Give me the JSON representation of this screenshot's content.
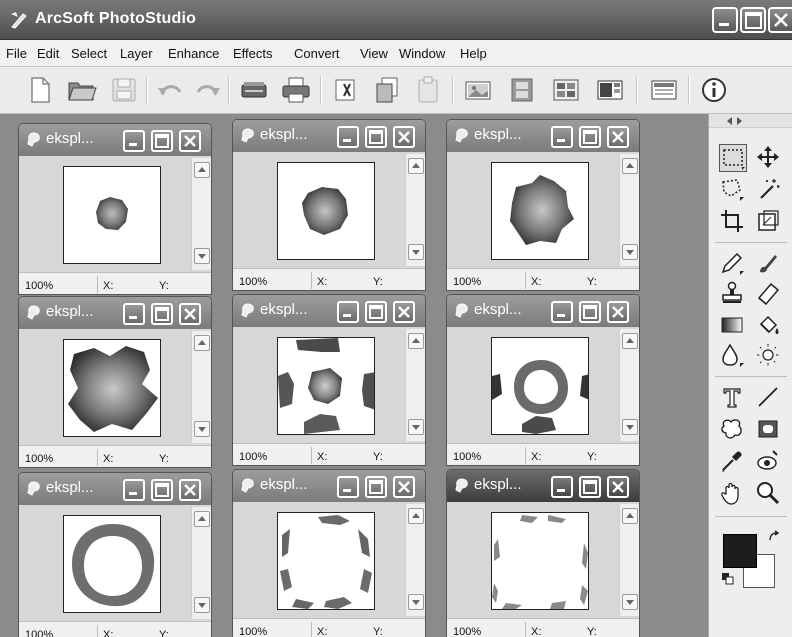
{
  "app": {
    "title": "ArcSoft PhotoStudio"
  },
  "menu": [
    "File",
    "Edit",
    "Select",
    "Layer",
    "Enhance",
    "Effects",
    "Convert",
    "View",
    "Window",
    "Help"
  ],
  "toolbar_icons": [
    "new-file-icon",
    "open-folder-icon",
    "save-icon",
    "undo-icon",
    "redo-icon",
    "scanner-icon",
    "print-icon",
    "cut-icon",
    "copy-icon",
    "paste-icon",
    "photo-icon",
    "filmstrip-icon",
    "organizer-icon",
    "slideshow-icon",
    "browser-icon",
    "info-icon"
  ],
  "documents": [
    {
      "title": "ekspl...",
      "zoom": "100%",
      "x_label": "X:",
      "y_label": "Y:",
      "stage": 1,
      "active": false
    },
    {
      "title": "ekspl...",
      "zoom": "100%",
      "x_label": "X:",
      "y_label": "Y:",
      "stage": 2,
      "active": false
    },
    {
      "title": "ekspl...",
      "zoom": "100%",
      "x_label": "X:",
      "y_label": "Y:",
      "stage": 3,
      "active": false
    },
    {
      "title": "ekspl...",
      "zoom": "100%",
      "x_label": "X:",
      "y_label": "Y:",
      "stage": 4,
      "active": false
    },
    {
      "title": "ekspl...",
      "zoom": "100%",
      "x_label": "X:",
      "y_label": "Y:",
      "stage": 5,
      "active": false
    },
    {
      "title": "ekspl...",
      "zoom": "100%",
      "x_label": "X:",
      "y_label": "Y:",
      "stage": 6,
      "active": false
    },
    {
      "title": "ekspl...",
      "zoom": "100%",
      "x_label": "X:",
      "y_label": "Y:",
      "stage": 7,
      "active": false
    },
    {
      "title": "ekspl...",
      "zoom": "100%",
      "x_label": "X:",
      "y_label": "Y:",
      "stage": 8,
      "active": false
    },
    {
      "title": "ekspl...",
      "zoom": "100%",
      "x_label": "X:",
      "y_label": "Y:",
      "stage": 9,
      "active": true
    }
  ],
  "tools": [
    "rect-select-icon",
    "move-icon",
    "lasso-icon",
    "magic-wand-icon",
    "crop-icon",
    "transform-icon",
    "pencil-icon",
    "brush-icon",
    "clone-stamp-icon",
    "eraser-icon",
    "gradient-icon",
    "paint-bucket-icon",
    "blur-drop-icon",
    "dodge-icon",
    "text-icon",
    "line-icon",
    "shape-icon",
    "frame-icon",
    "eyedropper-icon",
    "red-eye-icon",
    "hand-icon",
    "zoom-icon"
  ],
  "colors": {
    "foreground": "#1c1c1c",
    "background": "#ffffff",
    "title_bar": "#5a5a5a",
    "workspace": "#8b8b8b"
  }
}
